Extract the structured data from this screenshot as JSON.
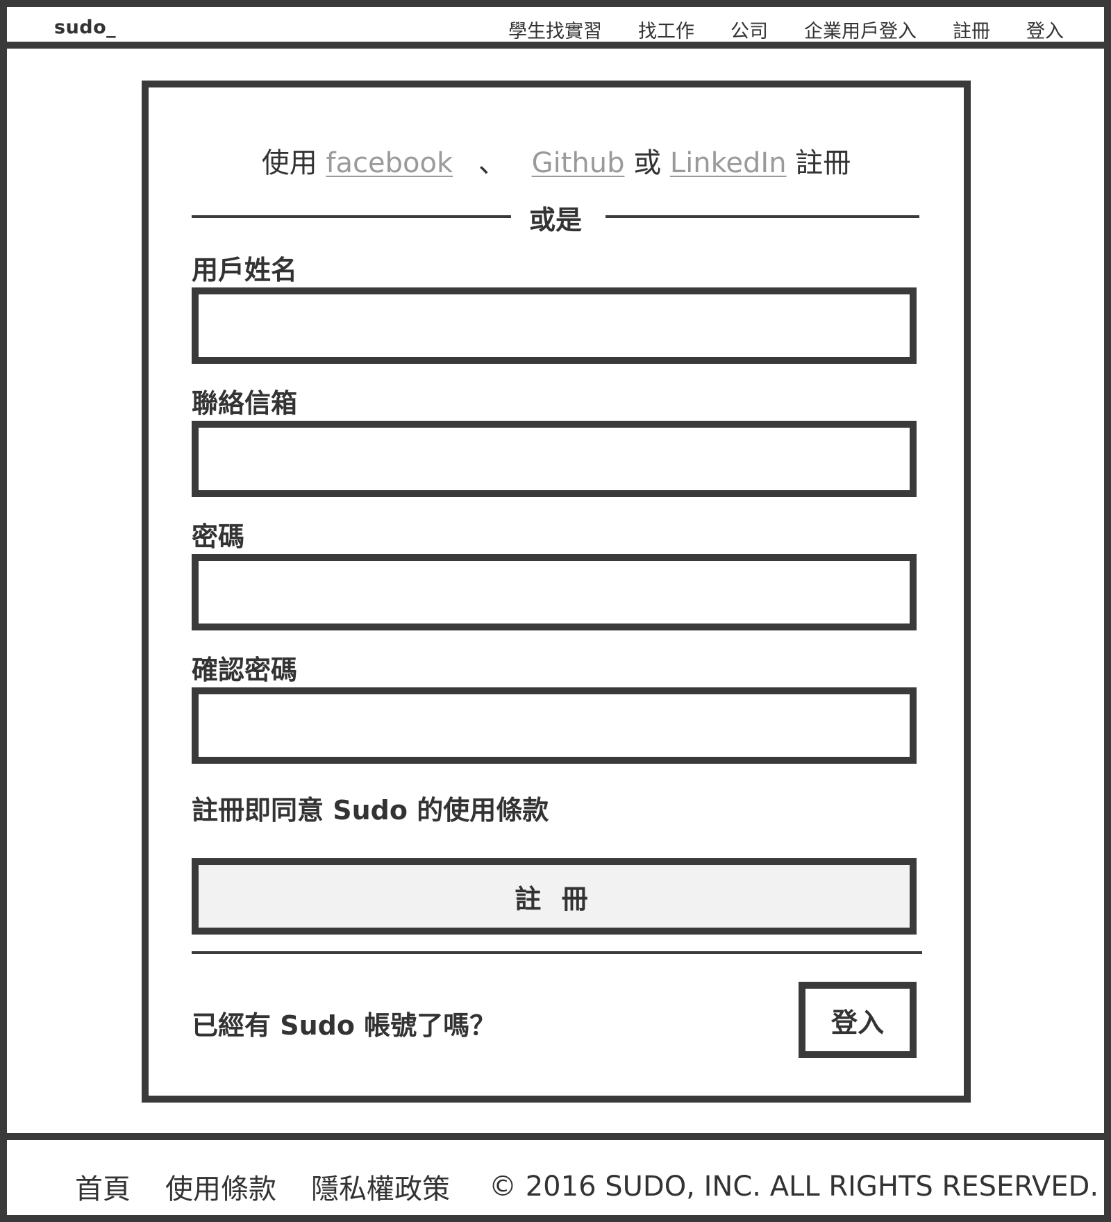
{
  "header": {
    "logo": "sudo_",
    "nav": [
      "學生找實習",
      "找工作",
      "公司",
      "企業用戶登入",
      "註冊",
      "登入"
    ]
  },
  "signup": {
    "social_prefix": "使用",
    "facebook": "facebook",
    "sep": "、",
    "github": "Github",
    "or_word": "或",
    "linkedin": "LinkedIn",
    "social_suffix": "註冊",
    "divider": "或是",
    "fields": [
      {
        "label": "用戶姓名",
        "value": ""
      },
      {
        "label": "聯絡信箱",
        "value": ""
      },
      {
        "label": "密碼",
        "value": ""
      },
      {
        "label": "確認密碼",
        "value": ""
      }
    ],
    "terms": "註冊即同意 Sudo 的使用條款",
    "submit": "註 冊",
    "have_account": "已經有 Sudo 帳號了嗎？",
    "login": "登入"
  },
  "footer": {
    "links": [
      "首頁",
      "使用條款",
      "隱私權政策"
    ],
    "copyright": "© 2016 SUDO, INC. ALL RIGHTS RESERVED."
  }
}
